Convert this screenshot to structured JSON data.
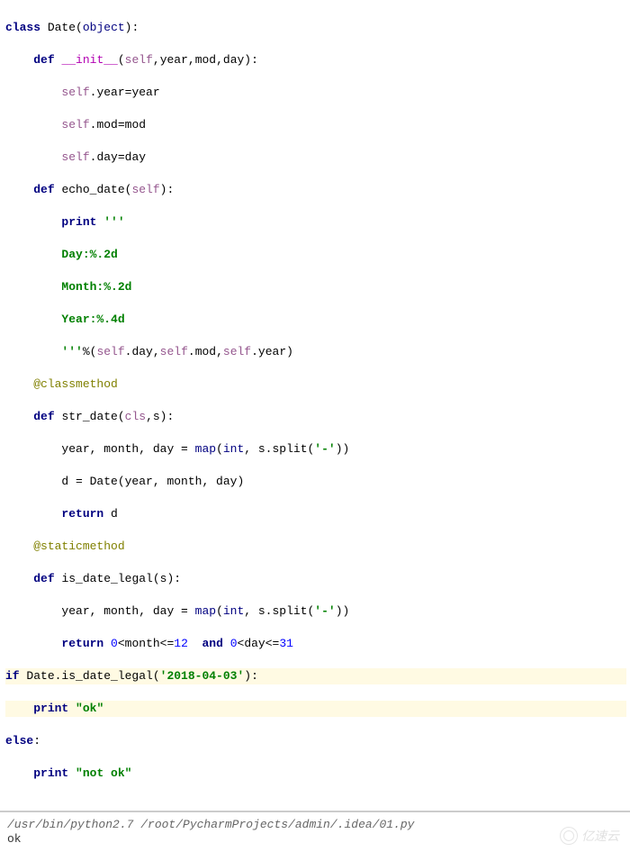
{
  "code": {
    "l1": {
      "kw1": "class",
      "name": "Date",
      "obj": "object"
    },
    "l2": {
      "kw": "def",
      "dunder": "__init__",
      "self": "self",
      "params": ",year,mod,day):"
    },
    "l3": {
      "self": "self",
      "rest": ".year=year"
    },
    "l4": {
      "self": "self",
      "rest": ".mod=mod"
    },
    "l5": {
      "self": "self",
      "rest": ".day=day"
    },
    "l6": {
      "kw": "def",
      "name": "echo_date(",
      "self": "self",
      "tail": "):"
    },
    "l7": {
      "kw": "print",
      "str": "'''"
    },
    "l8": {
      "str": "Day:%.2d"
    },
    "l9": {
      "str": "Month:%.2d"
    },
    "l10": {
      "str": "Year:%.4d"
    },
    "l11": {
      "str": "'''",
      "pct": "%(",
      "s1": "self",
      "d1": ".day,",
      "s2": "self",
      "d2": ".mod,",
      "s3": "self",
      "d3": ".year)"
    },
    "l12": {
      "dec": "@classmethod"
    },
    "l13": {
      "kw": "def",
      "name": "str_date(",
      "cls": "cls",
      "tail": ",s):"
    },
    "l14": {
      "txt1": "year, month, day = ",
      "map": "map",
      "txt2": "(",
      "int": "int",
      "txt3": ", s.split(",
      "str": "'-'",
      "txt4": "))"
    },
    "l15": {
      "txt": "d = Date(year, month, day)"
    },
    "l16": {
      "kw": "return",
      "txt": " d"
    },
    "l17": {
      "dec": "@staticmethod"
    },
    "l18": {
      "kw": "def",
      "name": "is_date_legal(s):"
    },
    "l19": {
      "txt1": "year, month, day = ",
      "map": "map",
      "txt2": "(",
      "int": "int",
      "txt3": ", s.split(",
      "str": "'-'",
      "txt4": "))"
    },
    "l20": {
      "kw": "return",
      "txt1": " ",
      "n0a": "0",
      "txt2": "<month<=",
      "n12": "12",
      "txt3": "  ",
      "kwand": "and",
      "txt4": " ",
      "n0b": "0",
      "txt5": "<day<=",
      "n31": "31"
    },
    "l21": {
      "kw": "if",
      "txt1": " Date.is_date_legal(",
      "str": "'2018-04-03'",
      "txt2": "):"
    },
    "l22": {
      "kw": "print",
      "sp": " ",
      "str": "\"ok\""
    },
    "l23": {
      "kw": "else",
      "txt": ":"
    },
    "l24": {
      "kw": "print",
      "sp": " ",
      "str": "\"not ok\""
    }
  },
  "output": {
    "path": "/usr/bin/python2.7 /root/PycharmProjects/admin/.idea/01.py",
    "result": "ok"
  },
  "watermark": "亿速云"
}
